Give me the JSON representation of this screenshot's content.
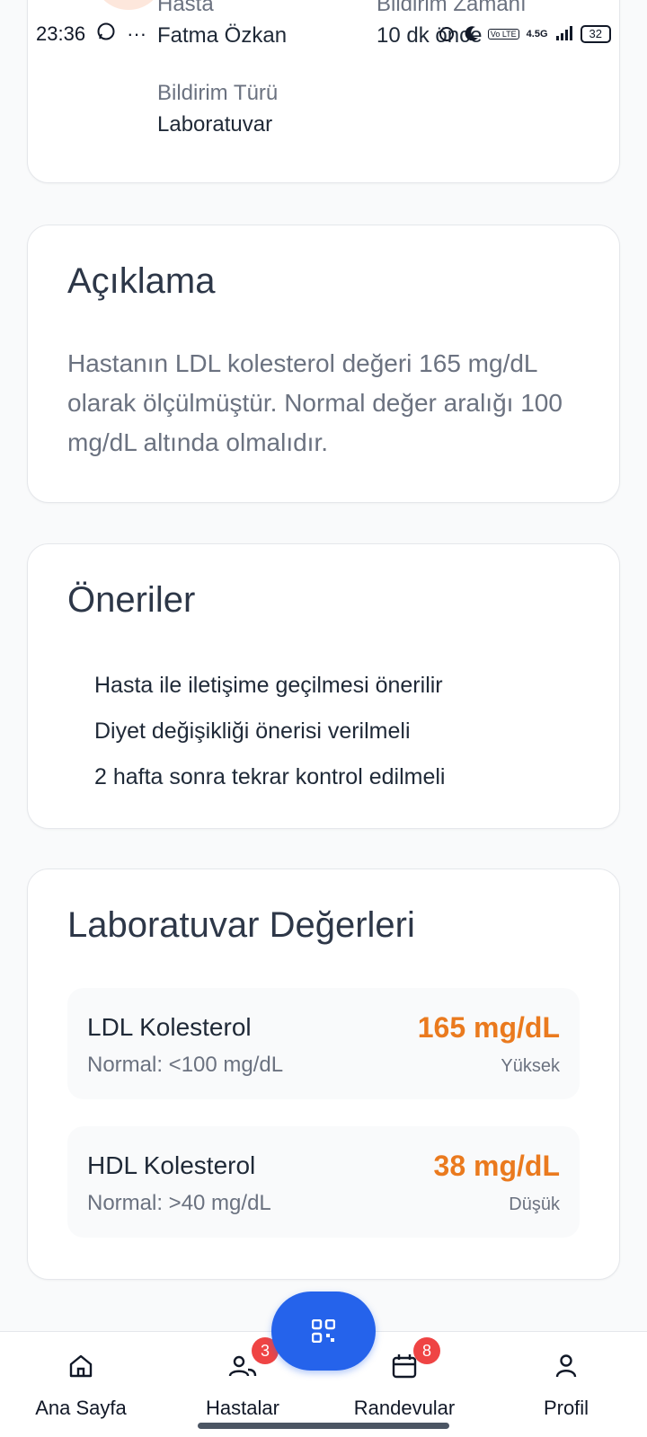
{
  "status_bar": {
    "time": "23:36",
    "more_dots": "···",
    "network": "4.5G",
    "volte": "Vo LTE",
    "battery": "32"
  },
  "header_card": {
    "patient_label": "Hasta",
    "patient_name": "Fatma Özkan",
    "time_label": "Bildirim Zamanı",
    "time_value": "10 dk önce",
    "type_label": "Bildirim Türü",
    "type_value": "Laboratuvar"
  },
  "description": {
    "title": "Açıklama",
    "text": "Hastanın LDL kolesterol değeri 165 mg/dL olarak ölçülmüştür. Normal değer aralığı 100 mg/dL altında olmalıdır."
  },
  "suggestions": {
    "title": "Öneriler",
    "items": [
      "Hasta ile iletişime geçilmesi önerilir",
      "Diyet değişikliği önerisi verilmeli",
      "2 hafta sonra tekrar kontrol edilmeli"
    ]
  },
  "lab_values": {
    "title": "Laboratuvar Değerleri",
    "items": [
      {
        "name": "LDL Kolesterol",
        "normal": "Normal: <100 mg/dL",
        "value": "165 mg/dL",
        "status": "Yüksek"
      },
      {
        "name": "HDL Kolesterol",
        "normal": "Normal: >40 mg/dL",
        "value": "38 mg/dL",
        "status": "Düşük"
      }
    ]
  },
  "nav": {
    "items": [
      {
        "label": "Ana Sayfa",
        "icon": "home-icon"
      },
      {
        "label": "Hastalar",
        "icon": "users-icon",
        "badge": "3"
      },
      {
        "label": "Randevular",
        "icon": "calendar-icon",
        "badge": "8"
      },
      {
        "label": "Profil",
        "icon": "user-icon"
      }
    ],
    "fab_icon": "qr-code-icon"
  },
  "colors": {
    "accent": "#2563eb",
    "warning": "#ea7a1e",
    "badge": "#ef4444"
  }
}
